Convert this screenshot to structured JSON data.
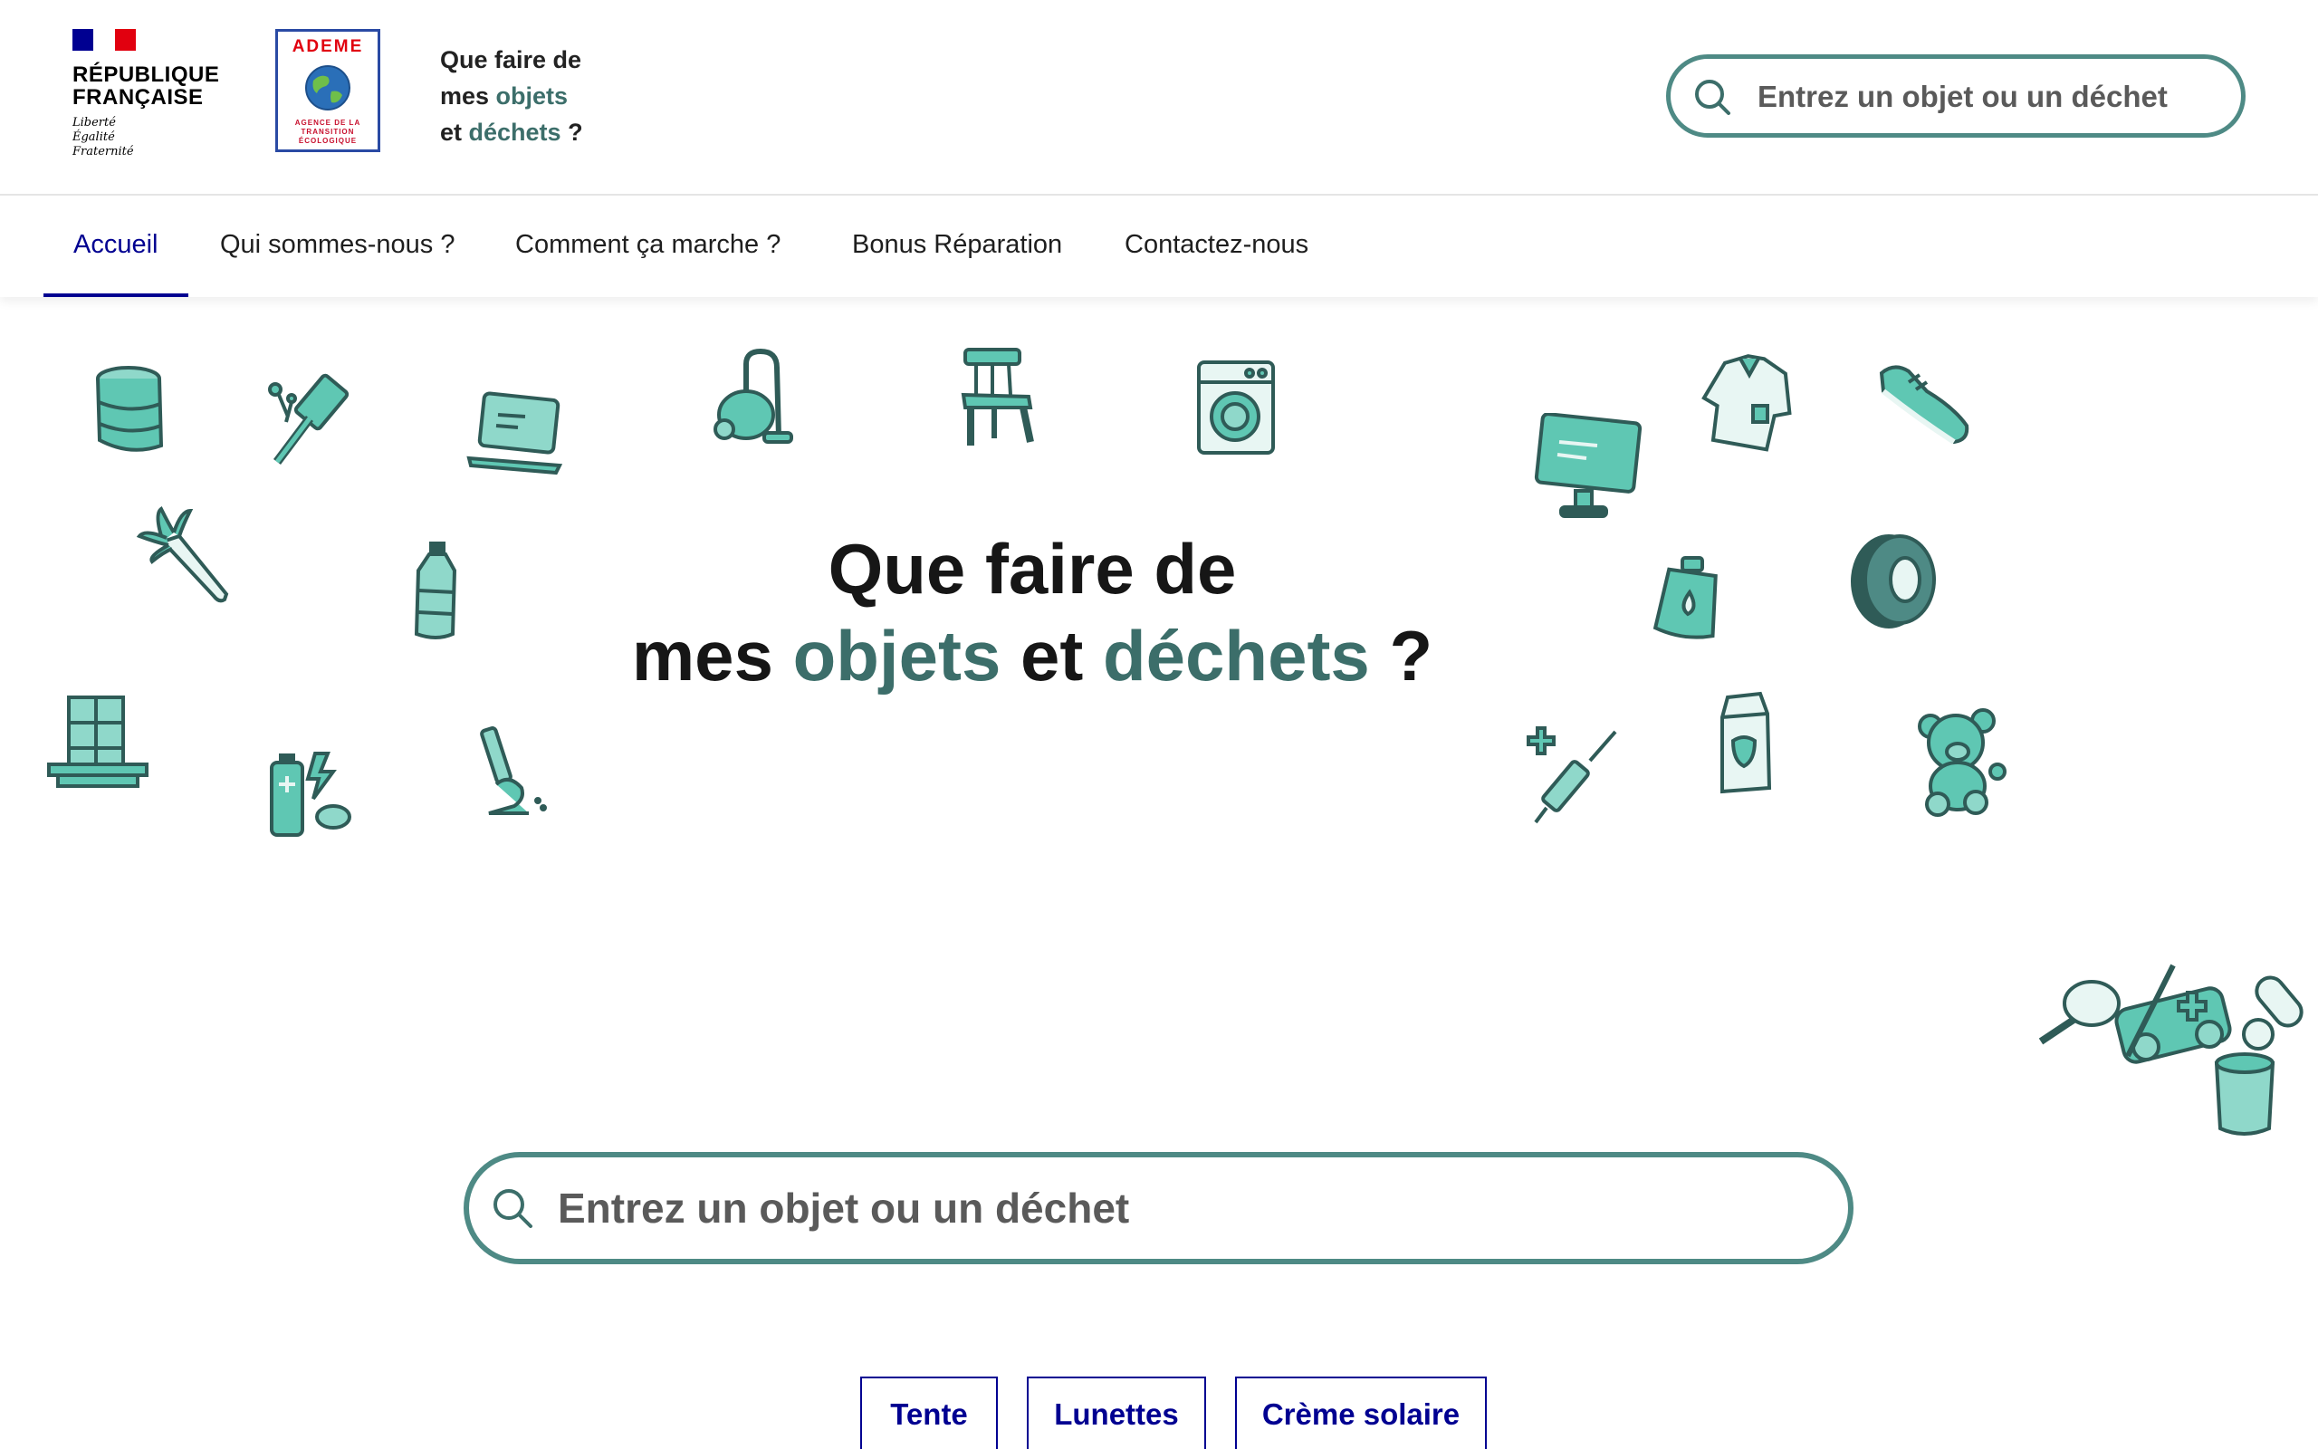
{
  "header": {
    "republique": [
      "RÉPUBLIQUE",
      "FRANÇAISE"
    ],
    "motto": [
      "Liberté",
      "Égalité",
      "Fraternité"
    ],
    "ademe_title": "ADEME",
    "ademe_sub": [
      "AGENCE DE LA",
      "TRANSITION",
      "ÉCOLOGIQUE"
    ],
    "site_title": {
      "line1": "Que faire de",
      "line2_a": "mes ",
      "line2_b": "objets",
      "line3_a": "et ",
      "line3_b": "déchets",
      "line3_c": " ?"
    },
    "search_placeholder": "Entrez un objet ou un déchet"
  },
  "nav": {
    "items": [
      {
        "label": "Accueil",
        "active": true
      },
      {
        "label": "Qui sommes-nous ?"
      },
      {
        "label": "Comment ça marche ?"
      },
      {
        "label": "Bonus Réparation"
      },
      {
        "label": "Contactez-nous"
      }
    ]
  },
  "hero": {
    "line1": "Que faire de",
    "line2_a": "mes ",
    "line2_b": "objets",
    "line2_c": " et ",
    "line2_d": "déchets",
    "line2_e": " ?"
  },
  "main_search": {
    "placeholder": "Entrez un objet ou un déchet"
  },
  "suggestions": [
    "Tente",
    "Lunettes",
    "Crème solaire"
  ],
  "colors": {
    "accent": "#3c6e6a",
    "icon_fill": "#5fc7b3",
    "icon_stroke": "#2f5b57",
    "nav_active": "#000091",
    "flag_blue": "#000091",
    "flag_red": "#e1000f"
  },
  "icons": [
    "barrel-icon",
    "hammer-icon",
    "laptop-icon",
    "vacuum-icon",
    "chair-icon",
    "washing-machine-icon",
    "monitor-icon",
    "shirt-icon",
    "sneaker-icon",
    "leek-icon",
    "bottle-icon",
    "detergent-icon",
    "tire-icon",
    "window-icon",
    "battery-icon",
    "cigarette-icon",
    "syringe-icon",
    "milk-carton-icon",
    "teddy-bear-icon",
    "object-pile-icon"
  ]
}
